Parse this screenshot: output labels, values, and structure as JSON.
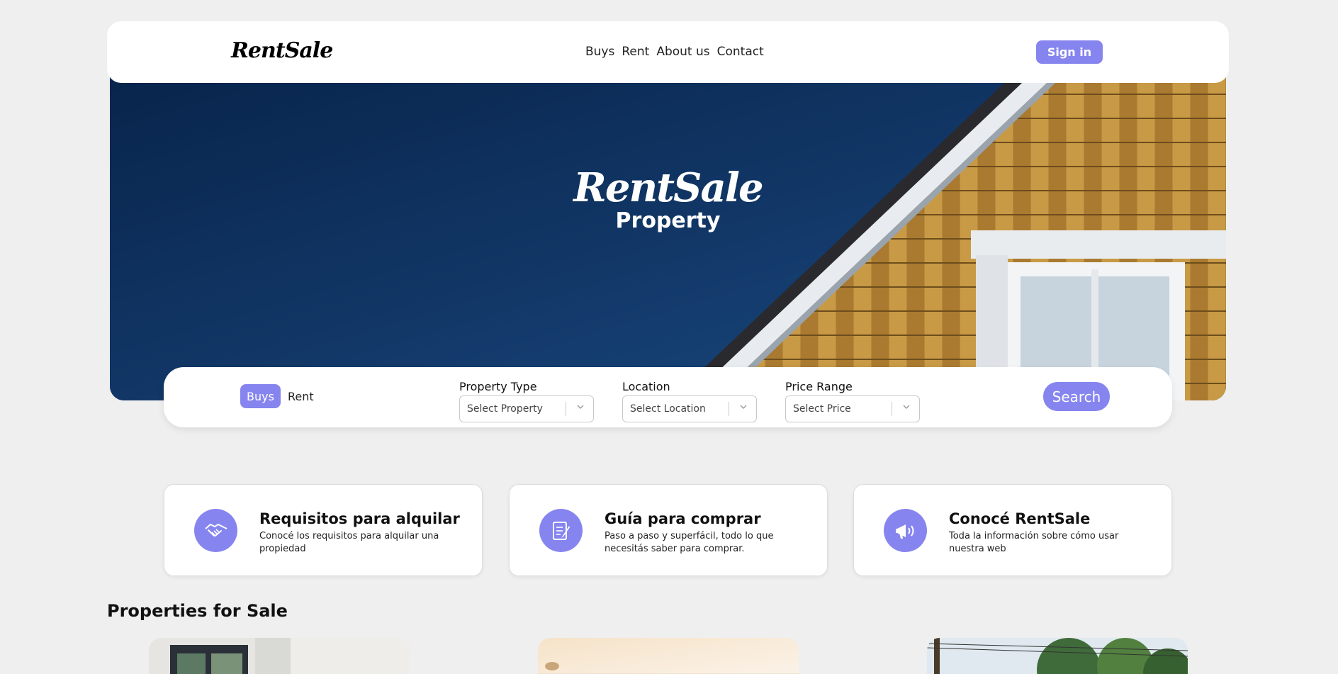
{
  "nav": {
    "logo": "RentSale",
    "links": [
      "Buys",
      "Rent",
      "About us",
      "Contact"
    ],
    "signin_label": "Sign in"
  },
  "hero": {
    "title": "RentSale",
    "subtitle": "Property"
  },
  "search": {
    "mode_buys": "Buys",
    "mode_rent": "Rent",
    "property_type": {
      "label": "Property Type",
      "placeholder": "Select Property"
    },
    "location": {
      "label": "Location",
      "placeholder": "Select Location"
    },
    "price_range": {
      "label": "Price Range",
      "placeholder": "Select Price"
    },
    "search_label": "Search"
  },
  "cards": [
    {
      "icon": "handshake-icon",
      "title": "Requisitos para alquilar",
      "desc": "Conocé los requisitos para alquilar una propiedad"
    },
    {
      "icon": "document-pen-icon",
      "title": "Guía para comprar",
      "desc": "Paso a paso y superfácil, todo lo que necesitás saber para comprar."
    },
    {
      "icon": "megaphone-icon",
      "title": "Conocé RentSale",
      "desc": "Toda la información sobre cómo usar nuestra web"
    }
  ],
  "properties": {
    "title": "Properties for Sale"
  },
  "colors": {
    "accent": "#8685ef",
    "background": "#efefef"
  }
}
